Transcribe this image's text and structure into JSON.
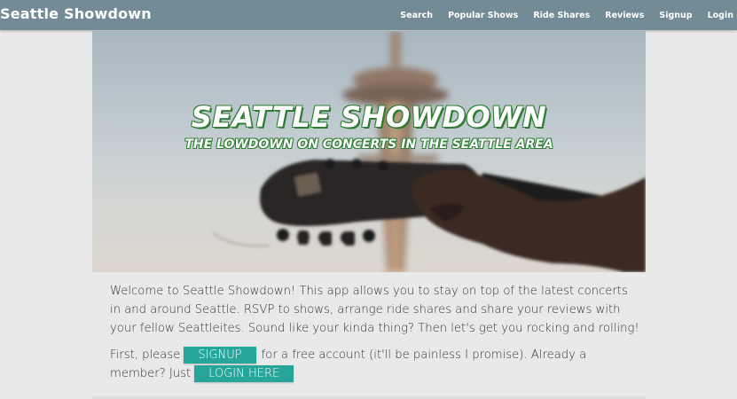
{
  "navbar": {
    "brand": "Seattle Showdown",
    "links": [
      "Search",
      "Popular Shows",
      "Ride Shares",
      "Reviews",
      "Signup",
      "Login"
    ]
  },
  "hero": {
    "title": "SEATTLE SHOWDOWN",
    "subtitle": "THE LOWDOWN ON CONCERTS IN THE SEATTLE AREA"
  },
  "content": {
    "intro": "Welcome to Seattle Showdown! This app allows you to stay on top of the latest concerts in and around Seattle. RSVP to shows, arrange ride shares and share your reviews with your fellow Seattleites. Sound like your kinda thing? Then let's get you rocking and rolling!",
    "cta_prefix": "First, please",
    "signup_button": "SIGNUP",
    "cta_middle": "for a free account (it'll be painless I promise). Already a member? Just",
    "login_button": "LOGIN HERE"
  },
  "colors": {
    "navbar": "#738b97",
    "button": "#26a69a",
    "title_shadow": "#2e7d32",
    "background": "#e9e9e9"
  }
}
